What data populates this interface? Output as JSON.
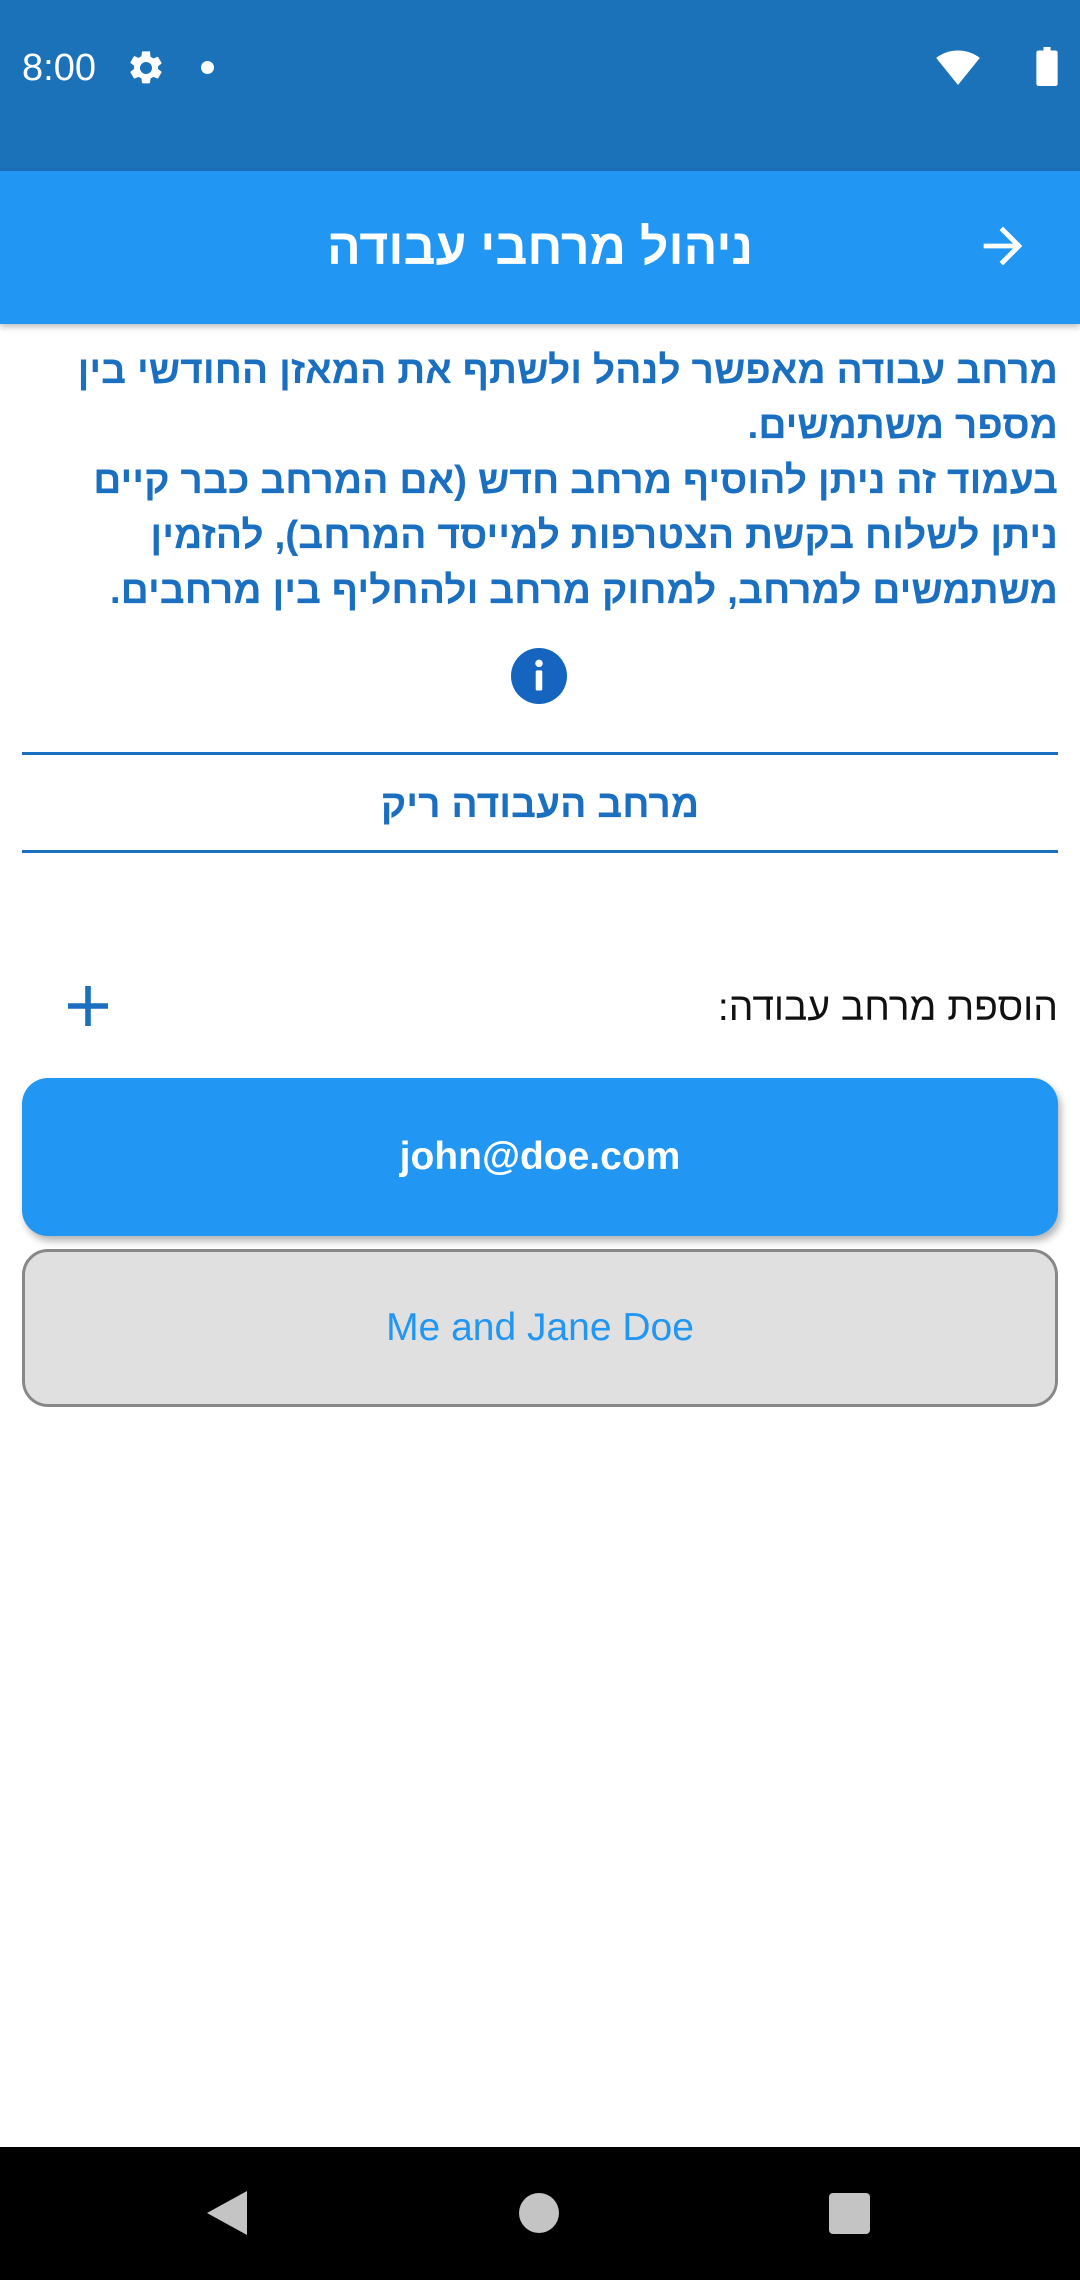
{
  "status_bar": {
    "time": "8:00",
    "icons": [
      "gear-icon",
      "notification-dot-icon",
      "wifi-icon",
      "battery-icon"
    ]
  },
  "app_bar": {
    "title": "ניהול מרחבי עבודה",
    "back_icon": "arrow-right-icon",
    "background_color": "#2196f3"
  },
  "intro": {
    "paragraph_1": "מרחב עבודה מאפשר לנהל ולשתף את המאזן החודשי בין מספר משתמשים.",
    "paragraph_2": "בעמוד זה ניתן להוסיף מרחב חדש (אם המרחב כבר קיים ניתן לשלוח בקשת הצטרפות למייסד המרחב), להזמין משתמשים למרחב, למחוק מרחב ולהחליף בין מרחבים.",
    "info_icon": "info-icon"
  },
  "current_workspace": {
    "status_text": "מרחב העבודה ריק"
  },
  "add_workspace": {
    "label": "הוספת מרחב עבודה:",
    "icon": "plus-icon"
  },
  "workspaces": [
    {
      "label": "john@doe.com",
      "selected": true
    },
    {
      "label": "Me and Jane Doe",
      "selected": false
    }
  ],
  "colors": {
    "status_bar": "#1c72b9",
    "primary": "#2196f3",
    "text_blue": "#1a6fc0"
  },
  "nav_bar": {
    "icons": [
      "back-triangle-icon",
      "home-circle-icon",
      "recents-square-icon"
    ]
  }
}
